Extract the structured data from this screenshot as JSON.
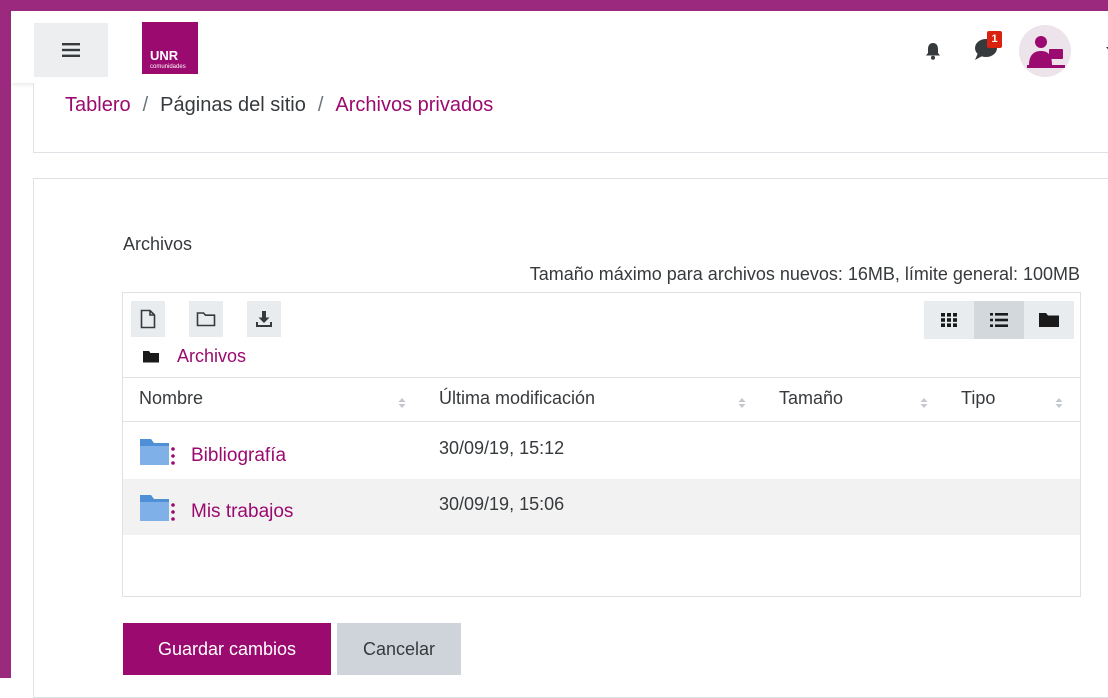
{
  "colors": {
    "brand": "#9b0a6f",
    "frame": "#9b2a7e",
    "badge": "#d9230f",
    "folder": "#4f8fd6"
  },
  "navbar": {
    "menu_icon": "hamburger-icon",
    "logo_title": "UNR",
    "logo_subtitle": "comunidades",
    "notifications_icon": "bell-icon",
    "messages_icon": "chat-bubble-icon",
    "messages_badge": "1",
    "user_menu_icon": "caret-down-icon"
  },
  "breadcrumb": {
    "items": [
      {
        "label": "Tablero",
        "link": true
      },
      {
        "label": "Páginas del sitio",
        "link": false
      },
      {
        "label": "Archivos privados",
        "link": true
      }
    ],
    "separator": "/"
  },
  "filemanager": {
    "section_label": "Archivos",
    "size_info": "Tamaño máximo para archivos nuevos: 16MB, límite general: 100MB",
    "toolbar": {
      "add_file_icon": "file-icon",
      "create_folder_icon": "folder-outline-icon",
      "download_icon": "download-icon"
    },
    "views": {
      "icons_icon": "grid-icon",
      "list_icon": "list-icon",
      "tree_icon": "folder-icon",
      "active": "list"
    },
    "path": "Archivos",
    "columns": [
      "Nombre",
      "Última modificación",
      "Tamaño",
      "Tipo"
    ],
    "rows": [
      {
        "name": "Bibliografía",
        "modified": "30/09/19, 15:12",
        "size": "",
        "type": ""
      },
      {
        "name": "Mis trabajos",
        "modified": "30/09/19, 15:06",
        "size": "",
        "type": ""
      }
    ]
  },
  "actions": {
    "save_label": "Guardar cambios",
    "cancel_label": "Cancelar"
  }
}
